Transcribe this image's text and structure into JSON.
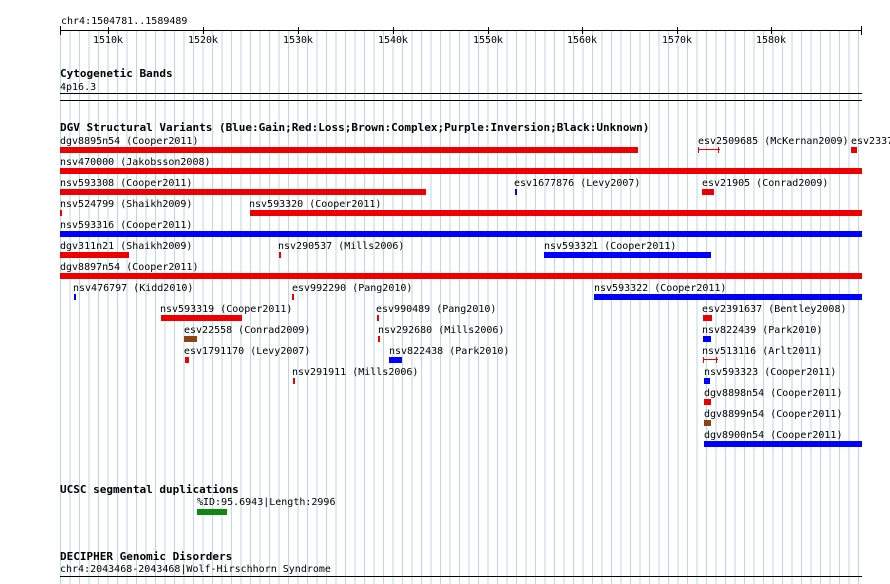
{
  "locus": "chr4:1504781..1589489",
  "ruler": {
    "ticks": [
      "1510k",
      "1520k",
      "1530k",
      "1540k",
      "1550k",
      "1560k",
      "1570k",
      "1580k"
    ]
  },
  "cytoband": {
    "title": "Cytogenetic Bands",
    "band": "4p16.3"
  },
  "dgv": {
    "title": "DGV Structural Variants (Blue:Gain;Red:Loss;Brown:Complex;Purple:Inversion;Black:Unknown)",
    "colors": {
      "gain": "#0000ff",
      "loss": "#ee0000",
      "complex": "#8b4513"
    },
    "variants": [
      {
        "label": "dgv8895n54 (Cooper2011)",
        "type": "loss"
      },
      {
        "label": "esv2509685 (McKernan2009)",
        "type": "loss"
      },
      {
        "label": "esv2337",
        "type": "loss"
      },
      {
        "label": "nsv470000 (Jakobsson2008)",
        "type": "loss"
      },
      {
        "label": "nsv593308 (Cooper2011)",
        "type": "loss"
      },
      {
        "label": "esv1677876 (Levy2007)",
        "type": "gain"
      },
      {
        "label": "esv21905 (Conrad2009)",
        "type": "loss"
      },
      {
        "label": "nsv524799 (Shaikh2009)",
        "type": "loss"
      },
      {
        "label": "nsv593320 (Cooper2011)",
        "type": "loss"
      },
      {
        "label": "nsv593316 (Cooper2011)",
        "type": "gain"
      },
      {
        "label": "dgv311n21 (Shaikh2009)",
        "type": "loss"
      },
      {
        "label": "nsv290537 (Mills2006)",
        "type": "loss"
      },
      {
        "label": "nsv593321 (Cooper2011)",
        "type": "gain"
      },
      {
        "label": "dgv8897n54 (Cooper2011)",
        "type": "loss"
      },
      {
        "label": "nsv476797 (Kidd2010)",
        "type": "gain"
      },
      {
        "label": "esv992290 (Pang2010)",
        "type": "loss"
      },
      {
        "label": "nsv593322 (Cooper2011)",
        "type": "gain"
      },
      {
        "label": "nsv593319 (Cooper2011)",
        "type": "loss"
      },
      {
        "label": "esv990489 (Pang2010)",
        "type": "loss"
      },
      {
        "label": "esv2391637 (Bentley2008)",
        "type": "loss"
      },
      {
        "label": "esv22558 (Conrad2009)",
        "type": "complex"
      },
      {
        "label": "nsv292680 (Mills2006)",
        "type": "loss"
      },
      {
        "label": "nsv822439 (Park2010)",
        "type": "gain"
      },
      {
        "label": "esv1791170 (Levy2007)",
        "type": "loss"
      },
      {
        "label": "nsv822438 (Park2010)",
        "type": "gain"
      },
      {
        "label": "nsv513116 (Arlt2011)",
        "type": "loss"
      },
      {
        "label": "nsv291911 (Mills2006)",
        "type": "loss"
      },
      {
        "label": "nsv593323 (Cooper2011)",
        "type": "gain"
      },
      {
        "label": "dgv8898n54 (Cooper2011)",
        "type": "loss"
      },
      {
        "label": "dgv8899n54 (Cooper2011)",
        "type": "complex"
      },
      {
        "label": "dgv8900n54 (Cooper2011)",
        "type": "gain"
      }
    ]
  },
  "segdup": {
    "title": "UCSC segmental duplications",
    "item": "%ID:95.6943|Length:2996",
    "color": "#118811"
  },
  "decipher": {
    "title": "DECIPHER Genomic Disorders",
    "item": "chr4:2043468-2043468|Wolf-Hirschhorn Syndrome"
  }
}
